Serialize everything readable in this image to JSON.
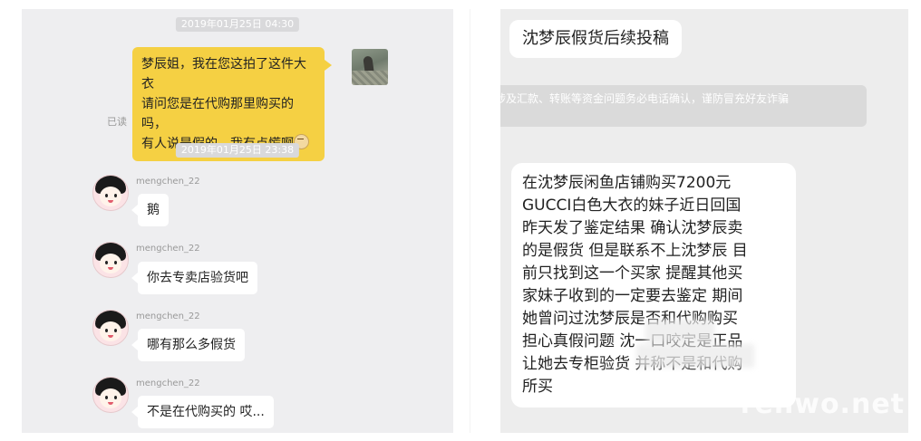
{
  "left_chat": {
    "timestamp_1": "2019年01月25日 04:30",
    "my_message": [
      "梦辰姐，我在您这拍了这件大衣",
      "请问您是在代购那里购买的吗，",
      "有人说是假的，我有点慌啊"
    ],
    "read_status": "已读",
    "timestamp_2": "2019年01月25日 23:38",
    "replies": [
      {
        "user": "mengchen_22",
        "text": "鹅"
      },
      {
        "user": "mengchen_22",
        "text": "你去专卖店验货吧"
      },
      {
        "user": "mengchen_22",
        "text": "哪有那么多假货"
      },
      {
        "user": "mengchen_22",
        "text": "不是在代购买的  哎..."
      }
    ]
  },
  "right_chat": {
    "title": "沈梦辰假货后续投稿",
    "notice": "涉及汇款、转账等资金问题务必电话确认，谨防冒充好友诈骗",
    "story_lines": [
      "在沈梦辰闲鱼店铺购买7200元",
      "GUCCI白色大衣的妹子近日回国",
      "昨天发了鉴定结果 确认沈梦辰卖",
      "的是假货 但是联系不上沈梦辰 目",
      "前只找到这一个买家 提醒其他买",
      "家妹子收到的一定要去鉴定 期间",
      "她曾问过沈梦辰是否和代购购买",
      "担心真假问题 沈一口咬定是正品",
      "让她去专柜验货 并称不是和代购",
      "所买"
    ],
    "watermark": "renwo.net"
  },
  "colors": {
    "my_bubble": "#f5d043",
    "panel_bg": "#eeeef0",
    "other_bubble": "#ffffff"
  },
  "icons": [
    "emoji-sweat-icon",
    "user-photo-avatar",
    "cartoon-girl-avatar-icon"
  ]
}
